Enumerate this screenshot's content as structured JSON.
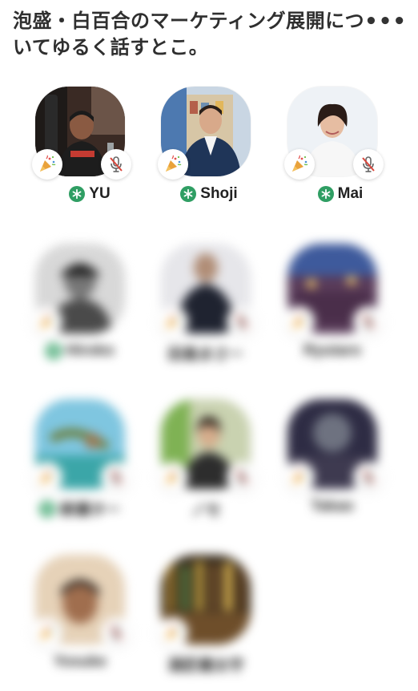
{
  "room": {
    "title": "泡盛・白百合のマーケティング展開についてゆるく話すとこ。",
    "more_label": "•••"
  },
  "speakers": [
    {
      "name": "YU",
      "new_user": true,
      "muted": true
    },
    {
      "name": "Shoji",
      "new_user": true,
      "muted": false
    },
    {
      "name": "Mai",
      "new_user": true,
      "muted": true
    }
  ],
  "listeners": [
    {
      "name": "Hiroko",
      "new_user": true
    },
    {
      "name": "田島まさー",
      "new_user": false
    },
    {
      "name": "Ryutaro",
      "new_user": false
    },
    {
      "name": "柳瀬ター",
      "new_user": true
    },
    {
      "name": "ノセ",
      "new_user": false
    },
    {
      "name": "Takao",
      "new_user": false
    },
    {
      "name": "Yosuke",
      "new_user": false
    },
    {
      "name": "酒匠健太守",
      "new_user": false
    }
  ],
  "icons": {
    "badge_left": "party-popper-icon",
    "badge_right": "muted-mic-icon",
    "name_prefix": "new-user-star-icon"
  },
  "colors": {
    "accent_green": "#2f9e63",
    "mute_red": "#d9463b"
  }
}
